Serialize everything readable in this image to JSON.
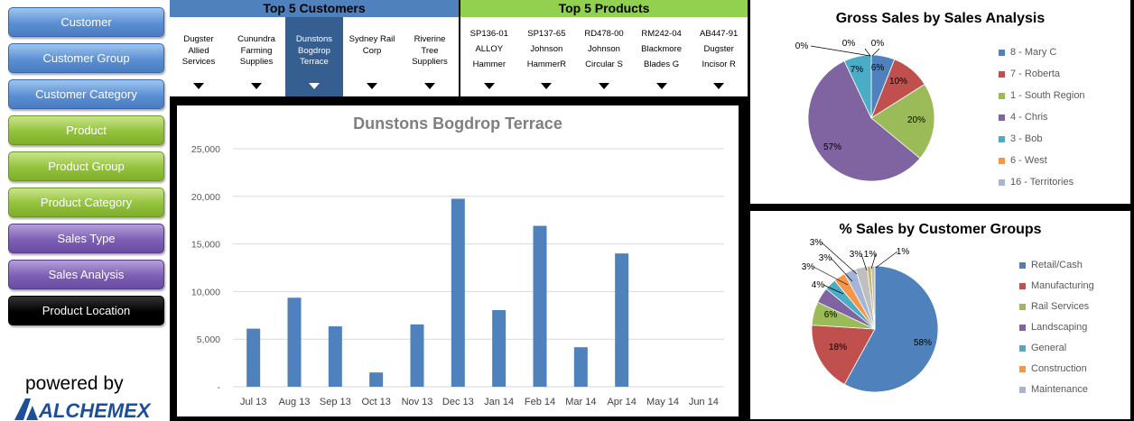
{
  "sidebar": {
    "buttons": [
      {
        "label": "Customer",
        "style": "blue"
      },
      {
        "label": "Customer Group",
        "style": "blue"
      },
      {
        "label": "Customer Category",
        "style": "blue"
      },
      {
        "label": "Product",
        "style": "green"
      },
      {
        "label": "Product Group",
        "style": "green"
      },
      {
        "label": "Product Category",
        "style": "green"
      },
      {
        "label": "Sales Type",
        "style": "purple"
      },
      {
        "label": "Sales Analysis",
        "style": "purple"
      },
      {
        "label": "Product Location",
        "style": "black"
      }
    ],
    "powered_by": "powered by",
    "logo_text": "ALCHEMEX"
  },
  "top_customers": {
    "header": "Top 5 Customers",
    "items": [
      "Dugster\nAllied\nServices",
      "Cunundra\nFarming\nSupplies",
      "Dunstons\nBogdrop\nTerrace",
      "Sydney Rail\nCorp",
      "Riverine\nTree\nSuppliers"
    ],
    "selected_index": 2
  },
  "top_products": {
    "header": "Top 5 Products",
    "items": [
      "SP136-01\nALLOY\nHammer",
      "SP137-65\nJohnson\nHammerR",
      "RD478-00\nJohnson\nCircular S",
      "RM242-04\nBlackmore\nBlades G",
      "AB447-91\nDugster\nIncisor R"
    ]
  },
  "colors": {
    "blue": "#4f81bd",
    "red": "#c0504d",
    "green": "#9bbb59",
    "purple": "#8064a2",
    "teal": "#4bacc6",
    "orange": "#f79646",
    "lightblue": "#a5b5d9",
    "gold": "#c9b36b",
    "gray": "#bfbfbf",
    "customers_header": "#4f81bd",
    "products_header": "#92d050"
  },
  "chart_data": [
    {
      "type": "bar",
      "title": "Dunstons Bogdrop Terrace",
      "categories": [
        "Jul 13",
        "Aug 13",
        "Sep 13",
        "Oct 13",
        "Nov 13",
        "Dec 13",
        "Jan 14",
        "Feb 14",
        "Mar 14",
        "Apr 14",
        "May 14",
        "Jun 14"
      ],
      "values": [
        6100,
        9350,
        6350,
        1500,
        6550,
        19750,
        8050,
        16900,
        4150,
        14000,
        0,
        0
      ],
      "ylim": [
        0,
        25000
      ],
      "yticks": [
        "-",
        "5,000",
        "10,000",
        "15,000",
        "20,000",
        "25,000"
      ],
      "grid": true
    },
    {
      "type": "pie",
      "title": "Gross Sales by Sales Analysis",
      "legend": [
        "8 - Mary C",
        "7 - Roberta",
        "1 - South Region",
        "4 - Chris",
        "3 - Bob",
        "6 - West",
        "16 - Territories"
      ],
      "values": [
        6,
        10,
        20,
        57,
        7,
        0,
        0
      ],
      "labels": [
        "6%",
        "10%",
        "20%",
        "57%",
        "7%",
        "0%",
        "0%"
      ],
      "extra_label": "0%"
    },
    {
      "type": "pie",
      "title": "% Sales by Customer Groups",
      "legend": [
        "Retail/Cash",
        "Manufacturing",
        "Rail Services",
        "Landscaping",
        "General",
        "Construction",
        "Maintenance"
      ],
      "values": [
        58,
        18,
        6,
        4,
        3,
        3,
        3,
        3,
        1,
        1
      ],
      "labels": [
        "58%",
        "18%",
        "6%",
        "4%",
        "3%",
        "3%",
        "3%",
        "3%",
        "1%",
        "1%"
      ]
    }
  ]
}
